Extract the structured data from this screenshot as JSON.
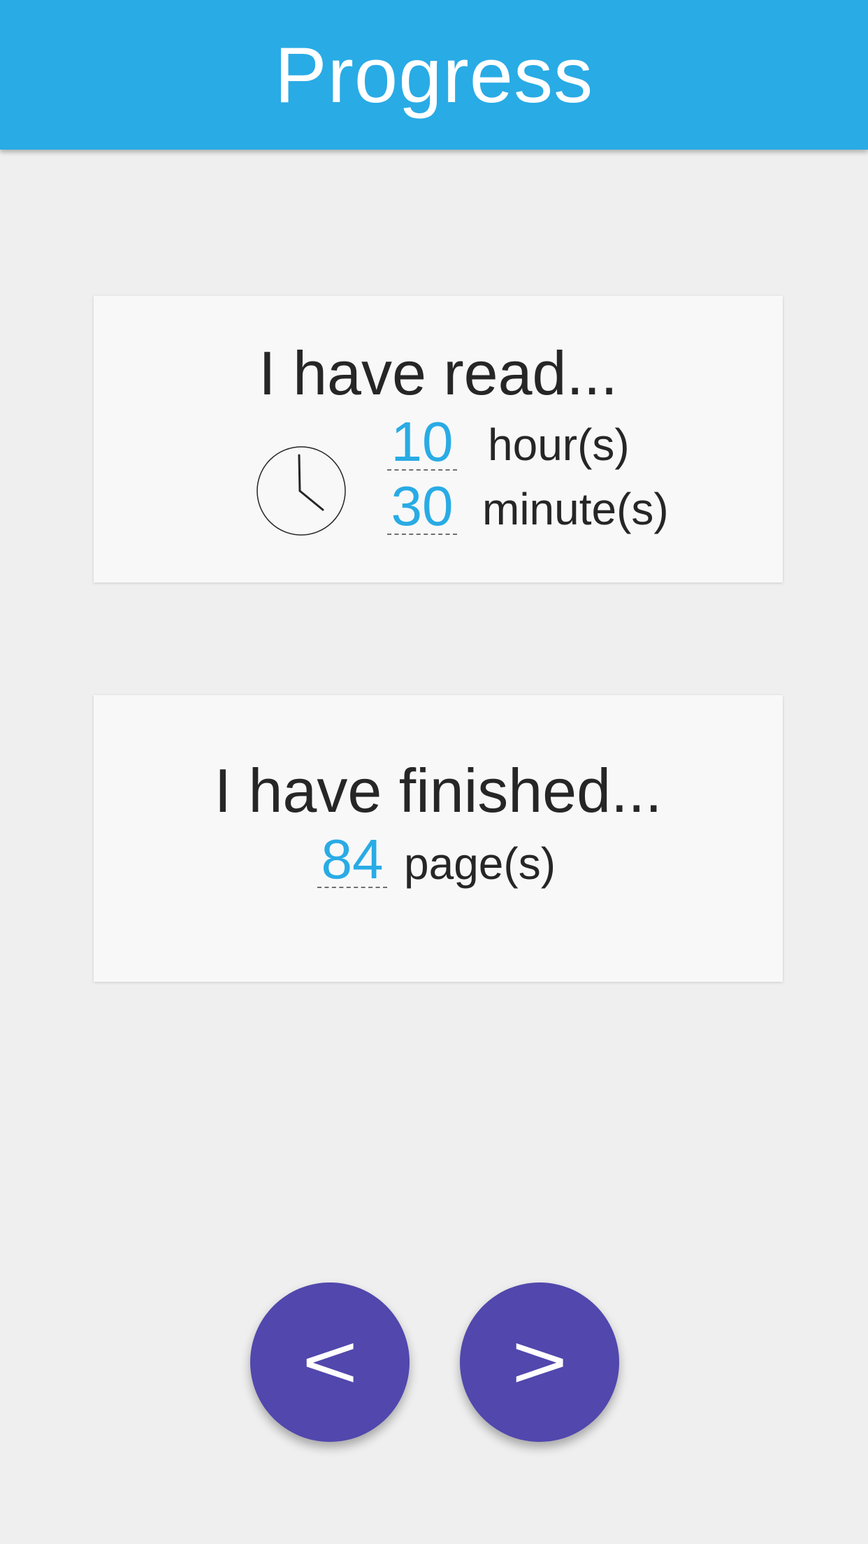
{
  "header": {
    "title": "Progress",
    "color": "#29abe5"
  },
  "read_card": {
    "heading": "I have read...",
    "icon": "clock-icon",
    "hours": {
      "value": "10",
      "unit": "hour(s)"
    },
    "minutes": {
      "value": "30",
      "unit": "minute(s)"
    }
  },
  "finished_card": {
    "heading": "I have finished...",
    "pages": {
      "value": "84",
      "unit": "page(s)"
    }
  },
  "navigation": {
    "back_label": "<",
    "next_label": ">",
    "button_color": "#5147ad"
  },
  "colors": {
    "accent": "#29abe5",
    "background": "#efefef",
    "card": "#f8f8f8"
  }
}
